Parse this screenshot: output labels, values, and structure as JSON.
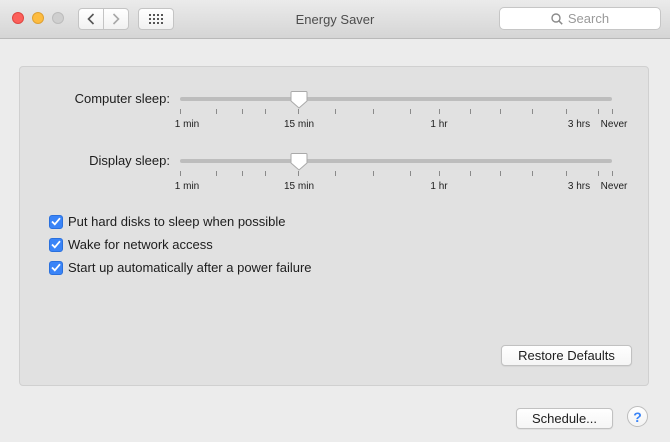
{
  "window": {
    "title": "Energy Saver",
    "traffic_colors": {
      "close": "#fc605b",
      "minimize": "#fdbc40",
      "zoom": "#cfcfcf"
    }
  },
  "toolbar": {
    "back_icon": "chevron-left-icon",
    "forward_icon": "chevron-right-icon",
    "grid_icon": "grid-icon",
    "search_placeholder": "Search"
  },
  "sliders": [
    {
      "label": "Computer sleep:",
      "value": "15 min",
      "ticks": [
        "1 min",
        "15 min",
        "1 hr",
        "3 hrs",
        "Never"
      ]
    },
    {
      "label": "Display sleep:",
      "value": "15 min",
      "ticks": [
        "1 min",
        "15 min",
        "1 hr",
        "3 hrs",
        "Never"
      ]
    }
  ],
  "checkboxes": [
    {
      "label": "Put hard disks to sleep when possible",
      "checked": true
    },
    {
      "label": "Wake for network access",
      "checked": true
    },
    {
      "label": "Start up automatically after a power failure",
      "checked": true
    }
  ],
  "buttons": {
    "restore": "Restore Defaults",
    "schedule": "Schedule...",
    "help": "?"
  },
  "accent_color": "#3a84f7"
}
